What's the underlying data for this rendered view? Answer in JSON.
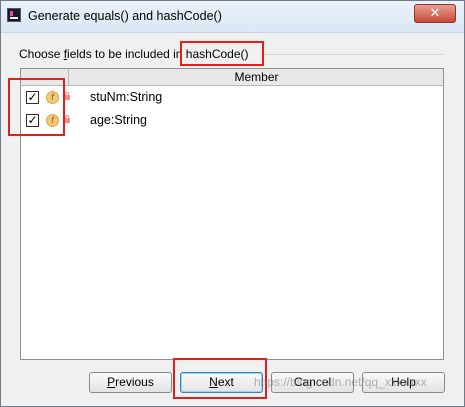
{
  "window": {
    "title": "Generate equals() and hashCode()",
    "close_glyph": "✕"
  },
  "prompt": {
    "before_mnemonic": "Choose ",
    "mnemonic": "f",
    "after_mnemonic": "ields to be included in hashCode()"
  },
  "table": {
    "column_header": "Member",
    "rows": [
      {
        "label": "stuNm:String",
        "checked": true,
        "check_glyph": "✓",
        "field_icon": "f"
      },
      {
        "label": "age:String",
        "checked": true,
        "check_glyph": "✓",
        "field_icon": "f"
      }
    ]
  },
  "buttons": {
    "previous": {
      "mnemonic": "P",
      "rest": "revious"
    },
    "next": {
      "mnemonic": "N",
      "rest": "ext"
    },
    "cancel": {
      "label": "Cancel"
    },
    "help": {
      "label": "Help"
    }
  },
  "watermark": "https://blog.csdn.net/qq_xxxxxxx",
  "colors": {
    "highlight_box": "#e0201f",
    "field_icon": "#f2c977",
    "lock_icon": "#f28b88"
  }
}
